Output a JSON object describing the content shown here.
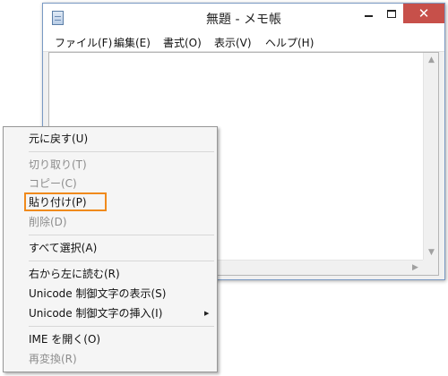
{
  "window": {
    "title": "無題 - メモ帳",
    "icon": "notepad-icon",
    "close_glyph": "✕"
  },
  "menubar": [
    "ファイル(F)",
    "編集(E)",
    "書式(O)",
    "表示(V)",
    "ヘルプ(H)"
  ],
  "context_menu": {
    "items": [
      {
        "label": "元に戻す(U)",
        "enabled": true
      },
      {
        "label": "切り取り(T)",
        "enabled": false
      },
      {
        "label": "コピー(C)",
        "enabled": false
      },
      {
        "label": "貼り付け(P)",
        "enabled": true,
        "highlighted": true
      },
      {
        "label": "削除(D)",
        "enabled": false
      },
      {
        "label": "すべて選択(A)",
        "enabled": true
      },
      {
        "label": "右から左に読む(R)",
        "enabled": true
      },
      {
        "label": "Unicode 制御文字の表示(S)",
        "enabled": true
      },
      {
        "label": "Unicode 制御文字の挿入(I)",
        "enabled": true,
        "submenu": true
      },
      {
        "label": "IME を開く(O)",
        "enabled": true
      },
      {
        "label": "再変換(R)",
        "enabled": false
      }
    ],
    "highlight_color": "#f08a1c"
  }
}
